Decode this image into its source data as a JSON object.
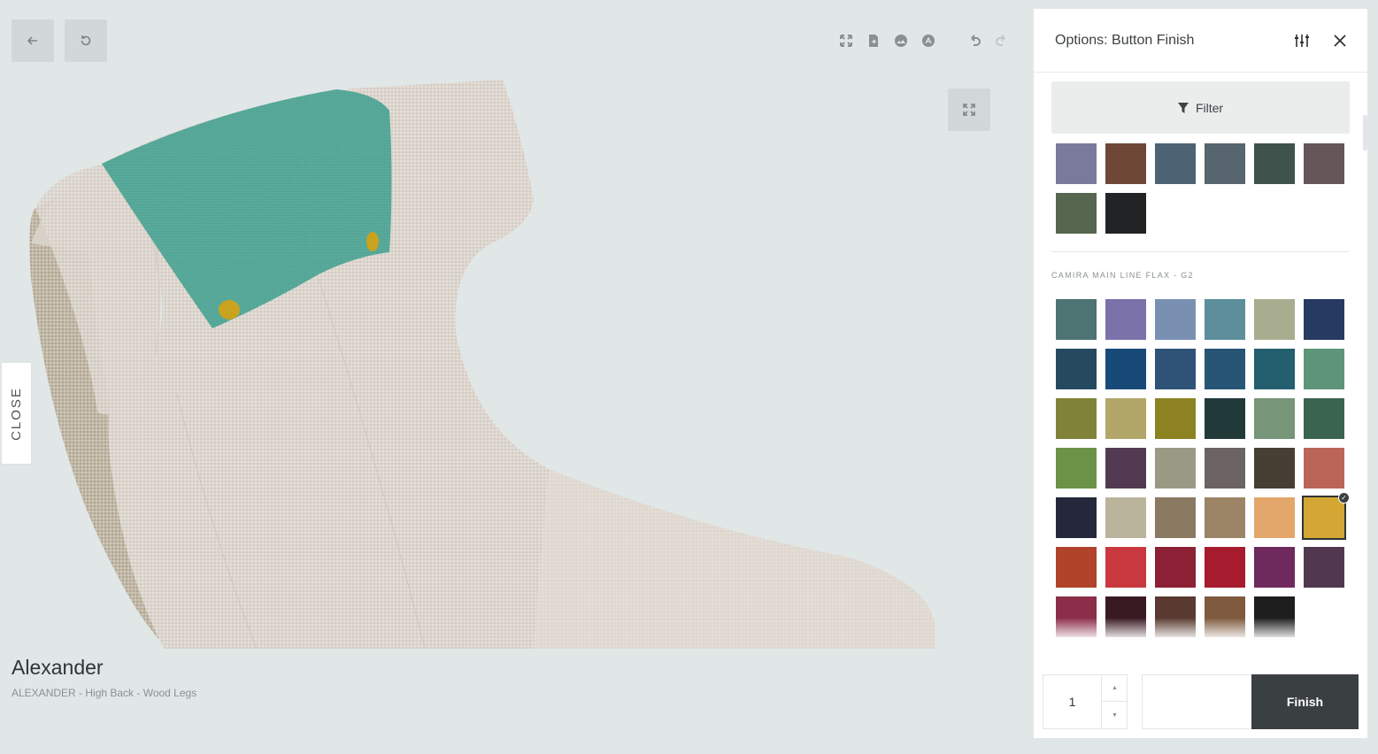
{
  "product": {
    "title": "Alexander",
    "subtitle": "ALEXANDER - High Back - Wood Legs"
  },
  "viewer": {
    "close_tab_label": "CLOSE",
    "toolbar_icons": [
      "expand-icon",
      "pdf-export-icon",
      "image-export-icon",
      "ar-icon",
      "undo-icon",
      "redo-icon"
    ]
  },
  "panel": {
    "title": "Options: Button Finish",
    "filter_label": "Filter",
    "section_label": "CAMIRA MAIN LINE FLAX - G2",
    "top_swatches": [
      "#7a7a9c",
      "#6e4737",
      "#4d6272",
      "#56656e",
      "#3f524b",
      "#665659",
      "#56664f",
      "#222324"
    ],
    "main_swatches": [
      "#4d7373",
      "#7a72a8",
      "#7a90b3",
      "#5c8e9c",
      "#a8ad8f",
      "#263a62",
      "#254a60",
      "#184a78",
      "#2e5377",
      "#275576",
      "#235f6e",
      "#5e9478",
      "#808239",
      "#b2a669",
      "#8c8222",
      "#22393a",
      "#769579",
      "#3a6350",
      "#6b9247",
      "#533a53",
      "#9a9a84",
      "#6b6462",
      "#463f33",
      "#bb6558",
      "#24283a",
      "#bbb49c",
      "#8a7a61",
      "#9c8467",
      "#e3a66b",
      "#d4a633",
      "#b0432a",
      "#c9383f",
      "#8c2034",
      "#a61b2d",
      "#6e2a5c",
      "#52384f",
      "#8c2e4a",
      "#3a1a22",
      "#5a3a30",
      "#7f5a3e",
      "#1e1e1f"
    ],
    "selected_swatch_index": 29,
    "quantity": "1",
    "finish_label": "Finish"
  }
}
